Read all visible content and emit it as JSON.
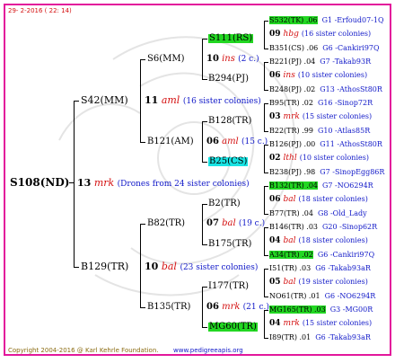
{
  "header": {
    "date": "29-  2-2016 ( 22: 14)"
  },
  "footer": {
    "copyright": "Copyright 2004-2016 @ Karl Kehrle Foundation.",
    "url": "www.pedigreeapis.org"
  },
  "root": {
    "id": "S108(ND)"
  },
  "gen1": {
    "num": "13",
    "race": "mrk",
    "note": "(Drones from 24 sister colonies)"
  },
  "n_top": {
    "id": "S42(MM)",
    "num": "11",
    "race": "aml",
    "note": "(16 sister colonies)"
  },
  "n_bot": {
    "id": "B129(TR)",
    "num": "10",
    "race": "bal",
    "note": "(23 sister colonies)"
  },
  "n_tt": {
    "id": "S6(MM)",
    "num": "10",
    "race": "ins",
    "note": "(2 c.)"
  },
  "n_tb": {
    "id": "B121(AM)",
    "num": "06",
    "race": "aml",
    "note": "(15 c.)"
  },
  "n_bt": {
    "id": "B82(TR)",
    "num": "07",
    "race": "bal",
    "note": "(19 c.)"
  },
  "n_bb": {
    "id": "B135(TR)",
    "num": "06",
    "race": "mrk",
    "note": "(21 c.)"
  },
  "g3": {
    "a": "S111(RS)",
    "b": "B294(PJ)",
    "c": "B128(TR)",
    "d": "B25(CS)",
    "e": "B2(TR)",
    "f": "B175(TR)",
    "g": "I177(TR)",
    "h": "MG60(TR)"
  },
  "g4": [
    {
      "line": "S532(TK) .06",
      "tail": "G1 -Erfoud07-1Q"
    },
    {
      "num": "09",
      "race": "hbg",
      "note": "(16 sister colonies)"
    },
    {
      "line": "B351(CS) .06",
      "tail": "G6 -Cankiri97Q"
    },
    {
      "line": "B221(PJ) .04",
      "tail": "G7 -Takab93R"
    },
    {
      "num": "06",
      "race": "ins",
      "note": "(10 sister colonies)"
    },
    {
      "line": "B248(PJ) .02",
      "tail": "G13 -AthosSt80R"
    },
    {
      "line": "B95(TR) .02",
      "tail": "G16 -Sinop72R"
    },
    {
      "num": "03",
      "race": "mrk",
      "note": "(15 sister colonies)"
    },
    {
      "line": "B22(TR) .99",
      "tail": "G10 -Atlas85R"
    },
    {
      "line": "B126(PJ) .00",
      "tail": "G11 -AthosSt80R"
    },
    {
      "num": "02",
      "race": "lthl",
      "note": "(10 sister colonies)"
    },
    {
      "line": "B238(PJ) .98",
      "tail": "G7 -SinopEgg86R"
    },
    {
      "line": "B132(TR) .04",
      "tail": "G7 -NO6294R"
    },
    {
      "num": "06",
      "race": "bal",
      "note": "(18 sister colonies)"
    },
    {
      "line": "B77(TR) .04",
      "tail": "G8 -Old_Lady"
    },
    {
      "line": "B146(TR) .03",
      "tail": "G20 -Sinop62R"
    },
    {
      "num": "04",
      "race": "bal",
      "note": "(18 sister colonies)"
    },
    {
      "line": "A34(TR) .02",
      "tail": "G6 -Cankiri97Q"
    },
    {
      "line": "I51(TR) .03",
      "tail": "G6 -Takab93aR"
    },
    {
      "num": "05",
      "race": "bal",
      "note": "(19 sister colonies)"
    },
    {
      "line": "NO61(TR) .01",
      "tail": "G6 -NO6294R"
    },
    {
      "line": "MG165(TR) .03",
      "tail": "G3 -MG00R"
    },
    {
      "num": "04",
      "race": "mrk",
      "note": "(15 sister colonies)"
    },
    {
      "line": "I89(TR) .01",
      "tail": "G6 -Takab93aR"
    }
  ],
  "colors": {
    "border": "#e3179b",
    "highlight_green": "#22d722",
    "highlight_cyan": "#19e3e3",
    "race_red": "#d41010",
    "note_blue": "#1018c8",
    "footer_brown": "#8a6a10"
  }
}
